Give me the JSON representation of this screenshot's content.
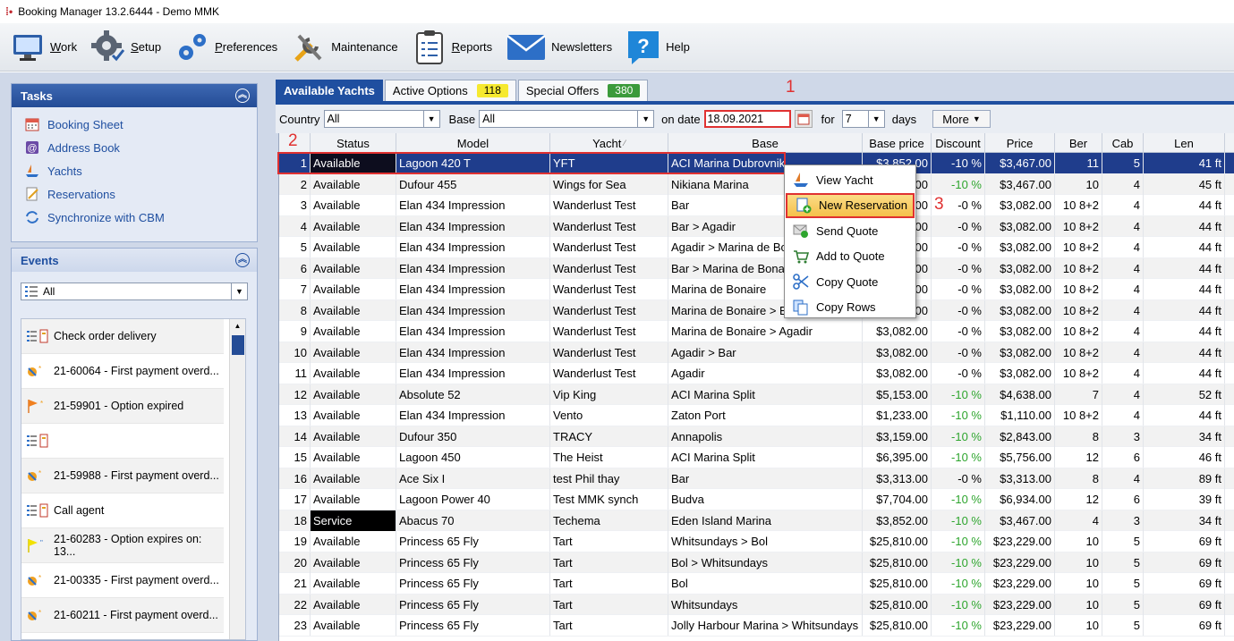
{
  "window": {
    "title": "Booking Manager 13.2.6444 - Demo MMK"
  },
  "toolbar": {
    "items": [
      {
        "label": "Work",
        "icon": "monitor-icon"
      },
      {
        "label": "Setup",
        "icon": "gear-icon"
      },
      {
        "label": "Preferences",
        "icon": "gears-icon"
      },
      {
        "label": "Maintenance",
        "icon": "tools-icon"
      },
      {
        "label": "Reports",
        "icon": "clipboard-icon"
      },
      {
        "label": "Newsletters",
        "icon": "envelope-icon"
      },
      {
        "label": "Help",
        "icon": "help-icon"
      }
    ]
  },
  "sidebar": {
    "tasks": {
      "title": "Tasks",
      "items": [
        {
          "label": "Booking Sheet",
          "icon": "calendar-icon"
        },
        {
          "label": "Address Book",
          "icon": "address-book-icon"
        },
        {
          "label": "Yachts",
          "icon": "yacht-icon"
        },
        {
          "label": "Reservations",
          "icon": "reservations-icon"
        },
        {
          "label": "Synchronize with CBM",
          "icon": "sync-icon"
        }
      ]
    },
    "events": {
      "title": "Events",
      "filter_value": "All",
      "items": [
        {
          "label": "Check order delivery",
          "icon": "list-icon"
        },
        {
          "label": "21-60064 - First payment overd...",
          "icon": "payment-icon"
        },
        {
          "label": "21-59901 - Option expired",
          "icon": "orange-flag-icon"
        },
        {
          "label": "",
          "icon": "list-icon"
        },
        {
          "label": "21-59988 - First payment overd...",
          "icon": "payment-icon"
        },
        {
          "label": "Call agent",
          "icon": "list-icon"
        },
        {
          "label": "21-60283 - Option expires on: 13...",
          "icon": "yellow-flag-icon"
        },
        {
          "label": "21-00335 - First payment overd...",
          "icon": "payment-icon"
        },
        {
          "label": "21-60211 - First payment overd...",
          "icon": "payment-icon"
        }
      ]
    }
  },
  "main": {
    "tabs": [
      {
        "label": "Available Yachts",
        "badge": ""
      },
      {
        "label": "Active Options",
        "badge": "118"
      },
      {
        "label": "Special Offers",
        "badge": "380"
      }
    ],
    "filters": {
      "country_label": "Country",
      "country_value": "All",
      "base_label": "Base",
      "base_value": "All",
      "date_label": "on date",
      "date_value": "18.09.2021",
      "for_label": "for",
      "days_value": "7",
      "days_label": "days",
      "more_label": "More"
    },
    "annotations": {
      "one": "1",
      "two": "2",
      "three": "3"
    },
    "grid": {
      "columns": [
        "",
        "Status",
        "Model",
        "Yacht",
        "Base",
        "Base price",
        "Discount",
        "Price",
        "Ber",
        "Cab",
        "Len"
      ],
      "sort_indicator": "⁄",
      "rows": [
        [
          "1",
          "Available",
          "Lagoon 420 T",
          "YFT",
          "ACI Marina Dubrovnik",
          "$3,852.00",
          "-10 %",
          "$3,467.00",
          "11",
          "5",
          "41 ft"
        ],
        [
          "2",
          "Available",
          "Dufour 455",
          "Wings for Sea",
          "Nikiana Marina",
          "$3,852.00",
          "-10 %",
          "$3,467.00",
          "10",
          "4",
          "45 ft"
        ],
        [
          "3",
          "Available",
          "Elan 434 Impression",
          "Wanderlust Test",
          "Bar",
          "$3,082.00",
          "-0 %",
          "$3,082.00",
          "10 8+2",
          "4",
          "44 ft"
        ],
        [
          "4",
          "Available",
          "Elan 434 Impression",
          "Wanderlust Test",
          "Bar > Agadir",
          "$3,082.00",
          "-0 %",
          "$3,082.00",
          "10 8+2",
          "4",
          "44 ft"
        ],
        [
          "5",
          "Available",
          "Elan 434 Impression",
          "Wanderlust Test",
          "Agadir > Marina de Bonaire",
          "$3,082.00",
          "-0 %",
          "$3,082.00",
          "10 8+2",
          "4",
          "44 ft"
        ],
        [
          "6",
          "Available",
          "Elan 434 Impression",
          "Wanderlust Test",
          "Bar > Marina de Bonaire",
          "$3,082.00",
          "-0 %",
          "$3,082.00",
          "10 8+2",
          "4",
          "44 ft"
        ],
        [
          "7",
          "Available",
          "Elan 434 Impression",
          "Wanderlust Test",
          "Marina de Bonaire",
          "$3,082.00",
          "-0 %",
          "$3,082.00",
          "10 8+2",
          "4",
          "44 ft"
        ],
        [
          "8",
          "Available",
          "Elan 434 Impression",
          "Wanderlust Test",
          "Marina de Bonaire > Bar",
          "$3,082.00",
          "-0 %",
          "$3,082.00",
          "10 8+2",
          "4",
          "44 ft"
        ],
        [
          "9",
          "Available",
          "Elan 434 Impression",
          "Wanderlust Test",
          "Marina de Bonaire > Agadir",
          "$3,082.00",
          "-0 %",
          "$3,082.00",
          "10 8+2",
          "4",
          "44 ft"
        ],
        [
          "10",
          "Available",
          "Elan 434 Impression",
          "Wanderlust Test",
          "Agadir > Bar",
          "$3,082.00",
          "-0 %",
          "$3,082.00",
          "10 8+2",
          "4",
          "44 ft"
        ],
        [
          "11",
          "Available",
          "Elan 434 Impression",
          "Wanderlust Test",
          "Agadir",
          "$3,082.00",
          "-0 %",
          "$3,082.00",
          "10 8+2",
          "4",
          "44 ft"
        ],
        [
          "12",
          "Available",
          "Absolute 52",
          "Vip King",
          "ACI Marina Split",
          "$5,153.00",
          "-10 %",
          "$4,638.00",
          "7",
          "4",
          "52 ft"
        ],
        [
          "13",
          "Available",
          "Elan 434 Impression",
          "Vento",
          "Zaton Port",
          "$1,233.00",
          "-10 %",
          "$1,110.00",
          "10 8+2",
          "4",
          "44 ft"
        ],
        [
          "14",
          "Available",
          "Dufour 350",
          "TRACY",
          "Annapolis",
          "$3,159.00",
          "-10 %",
          "$2,843.00",
          "8",
          "3",
          "34 ft"
        ],
        [
          "15",
          "Available",
          "Lagoon 450",
          "The Heist",
          "ACI Marina Split",
          "$6,395.00",
          "-10 %",
          "$5,756.00",
          "12",
          "6",
          "46 ft"
        ],
        [
          "16",
          "Available",
          "Ace Six I",
          "test Phil thay",
          "Bar",
          "$3,313.00",
          "-0 %",
          "$3,313.00",
          "8",
          "4",
          "89 ft"
        ],
        [
          "17",
          "Available",
          "Lagoon Power 40",
          "Test MMK synch",
          "Budva",
          "$7,704.00",
          "-10 %",
          "$6,934.00",
          "12",
          "6",
          "39 ft"
        ],
        [
          "18",
          "Service",
          "Abacus 70",
          "Techema",
          "Eden Island Marina",
          "$3,852.00",
          "-10 %",
          "$3,467.00",
          "4",
          "3",
          "34 ft"
        ],
        [
          "19",
          "Available",
          "Princess 65 Fly",
          "Tart",
          "Whitsundays > Bol",
          "$25,810.00",
          "-10 %",
          "$23,229.00",
          "10",
          "5",
          "69 ft"
        ],
        [
          "20",
          "Available",
          "Princess 65 Fly",
          "Tart",
          "Bol > Whitsundays",
          "$25,810.00",
          "-10 %",
          "$23,229.00",
          "10",
          "5",
          "69 ft"
        ],
        [
          "21",
          "Available",
          "Princess 65 Fly",
          "Tart",
          "Bol",
          "$25,810.00",
          "-10 %",
          "$23,229.00",
          "10",
          "5",
          "69 ft"
        ],
        [
          "22",
          "Available",
          "Princess 65 Fly",
          "Tart",
          "Whitsundays",
          "$25,810.00",
          "-10 %",
          "$23,229.00",
          "10",
          "5",
          "69 ft"
        ],
        [
          "23",
          "Available",
          "Princess 65 Fly",
          "Tart",
          "Jolly Harbour Marina > Whitsundays",
          "$25,810.00",
          "-10 %",
          "$23,229.00",
          "10",
          "5",
          "69 ft"
        ]
      ]
    },
    "context_menu": {
      "items": [
        {
          "label": "View Yacht",
          "icon": "yacht-icon"
        },
        {
          "label": "New Reservation",
          "icon": "new-reservation-icon"
        },
        {
          "label": "Send Quote",
          "icon": "send-quote-icon"
        },
        {
          "label": "Add to Quote",
          "icon": "cart-add-icon"
        },
        {
          "label": "Copy Quote",
          "icon": "scissors-icon"
        },
        {
          "label": "Copy Rows",
          "icon": "copy-icon"
        }
      ]
    }
  },
  "colors": {
    "accent": "#1f4fa0",
    "highlight": "#f5c04a",
    "annotation": "#e03131",
    "discount_green": "#2ea52e"
  }
}
